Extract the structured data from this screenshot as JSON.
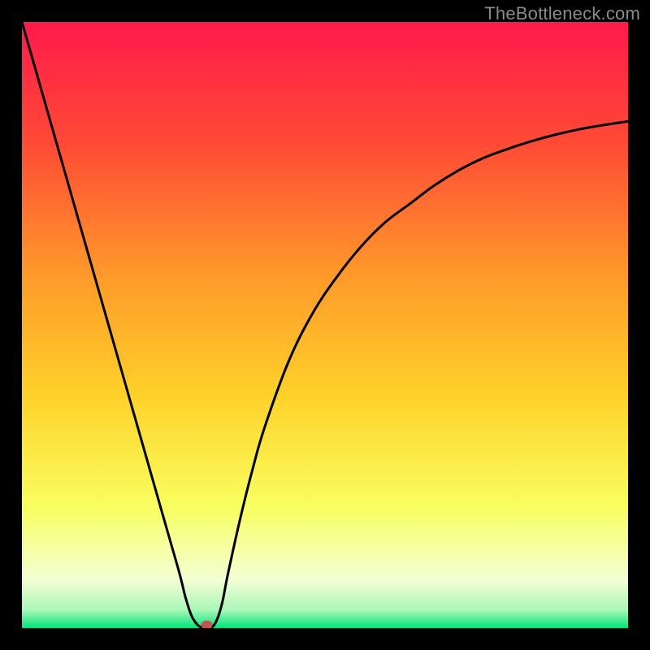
{
  "watermark": "TheBottleneck.com",
  "colors": {
    "frame": "#000000",
    "gradient_top": "#ff1a4b",
    "gradient_mid_upper": "#ff6a2a",
    "gradient_mid": "#ffd22a",
    "gradient_mid_lower": "#f8ff60",
    "gradient_base_light": "#f4ffd4",
    "gradient_green": "#00e57a",
    "curve": "#000000",
    "marker": "#c05555"
  },
  "chart_data": {
    "type": "line",
    "title": "",
    "xlabel": "",
    "ylabel": "",
    "xlim": [
      0,
      100
    ],
    "ylim": [
      0,
      100
    ],
    "grid": false,
    "x": [
      0,
      2,
      4,
      6,
      8,
      10,
      12,
      14,
      16,
      18,
      20,
      22,
      24,
      26,
      27,
      28,
      29,
      30,
      31,
      32,
      33,
      34,
      36,
      38,
      40,
      44,
      48,
      52,
      56,
      60,
      64,
      68,
      72,
      76,
      80,
      84,
      88,
      92,
      96,
      100
    ],
    "values": [
      100,
      93,
      86,
      79,
      72,
      65,
      58,
      51,
      44,
      37,
      30,
      23,
      16,
      9,
      5,
      2,
      0.5,
      0,
      0,
      1,
      4,
      9,
      18,
      26,
      33,
      44,
      52,
      58,
      63,
      67,
      70,
      73,
      75.5,
      77.5,
      79,
      80.3,
      81.4,
      82.3,
      83,
      83.6
    ],
    "marker": {
      "x": 30.5,
      "y": 0.5
    },
    "legend": []
  }
}
